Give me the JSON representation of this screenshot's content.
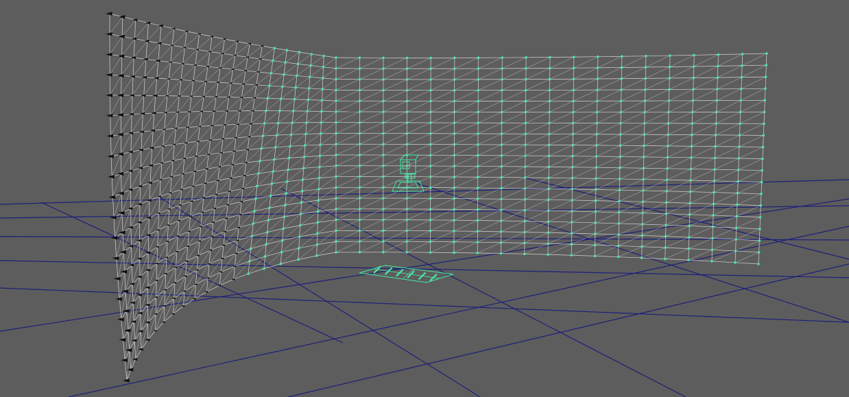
{
  "viewport": {
    "kind": "3d-perspective-viewport",
    "background_color": "#5d5d5d",
    "ground_grid": {
      "visible": true,
      "color": "#1c1f7a"
    },
    "wireframe_color": "#d6d6d6",
    "selection_color": "#46e8a8",
    "unselected_vertex_color": "#101010"
  },
  "scene_objects": [
    {
      "name": "curved-wall-mesh",
      "display": "wireframe",
      "partially_selected": true
    },
    {
      "name": "camera-object",
      "display": "wireframe",
      "selected": true
    },
    {
      "name": "area-light-plane",
      "display": "wireframe",
      "selected": true
    }
  ]
}
